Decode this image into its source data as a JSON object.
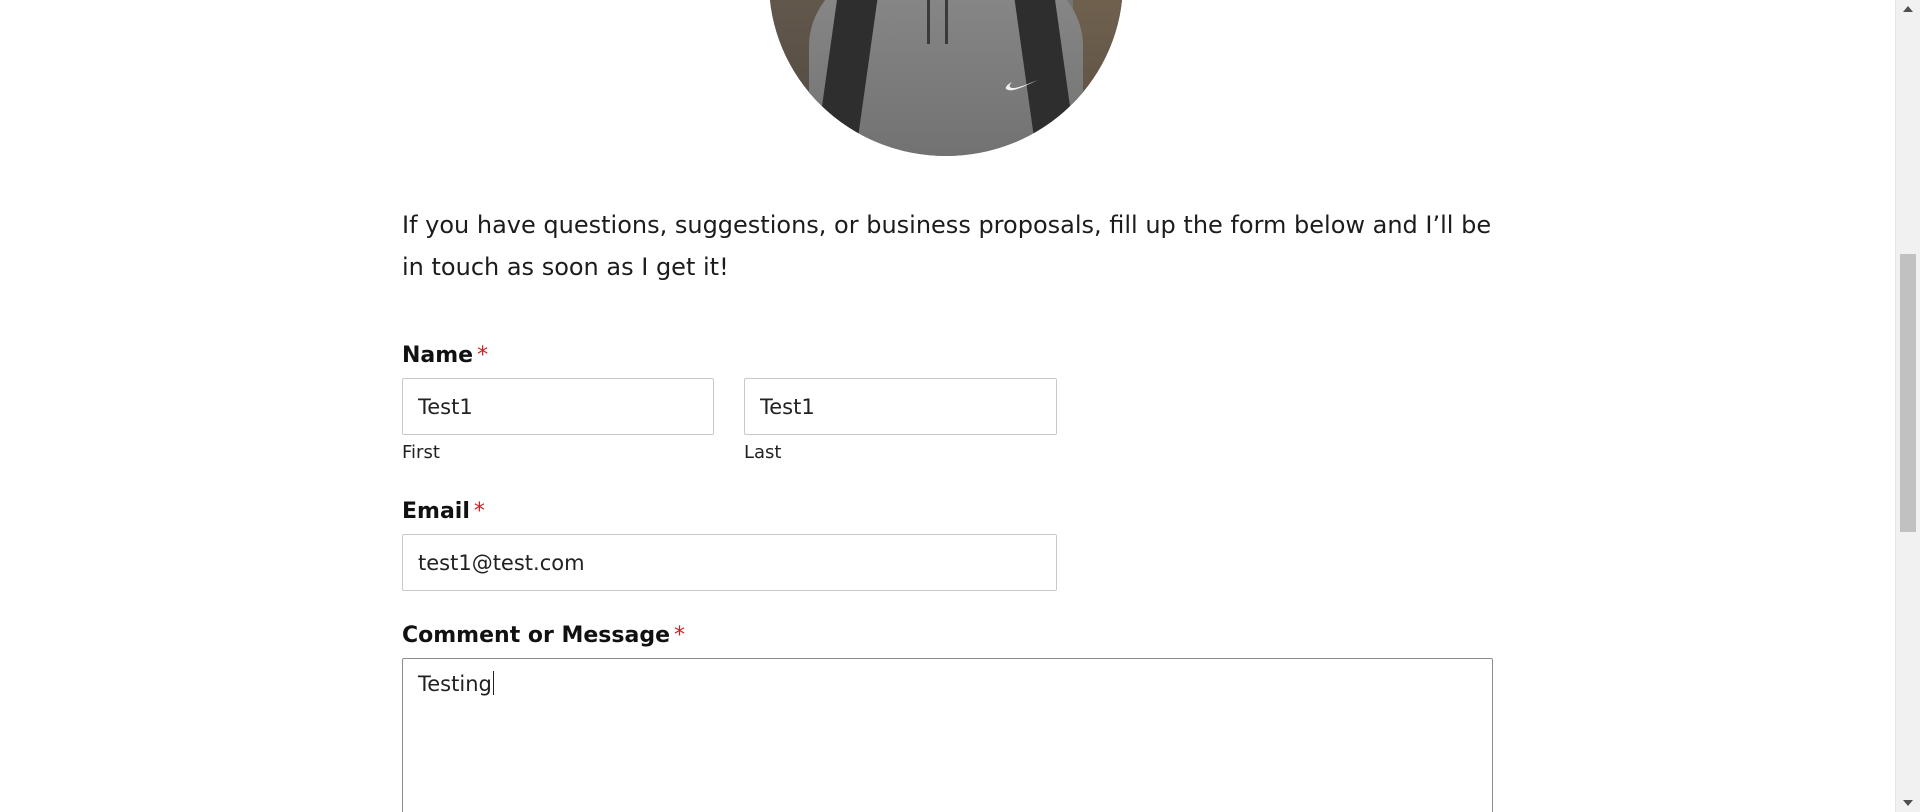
{
  "intro": {
    "text": "If you have questions, suggestions, or business proposals, fill up the form below and I’ll be in touch as soon as I get it!"
  },
  "form": {
    "name": {
      "label": "Name",
      "required_mark": "*",
      "first": {
        "value": "Test1",
        "sublabel": "First"
      },
      "last": {
        "value": "Test1",
        "sublabel": "Last"
      }
    },
    "email": {
      "label": "Email",
      "required_mark": "*",
      "value": "test1@test.com"
    },
    "message": {
      "label": "Comment or Message",
      "required_mark": "*",
      "value": "Testing"
    }
  },
  "colors": {
    "required": "#d21f1f",
    "input_border": "#c9c9c9",
    "active_border": "#8d8d8d",
    "scroll_thumb": "#c1c1c1"
  },
  "icons": {
    "scroll_up": "triangle-up",
    "scroll_down": "triangle-down"
  },
  "scroll": {
    "position_fraction": 0.3
  }
}
